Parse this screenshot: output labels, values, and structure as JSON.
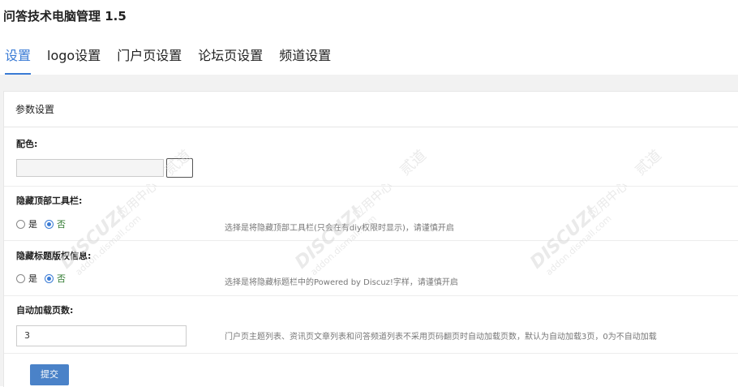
{
  "app": {
    "title": "问答技术电脑管理 1.5"
  },
  "tabs": [
    {
      "label": "设置",
      "active": true
    },
    {
      "label": "logo设置",
      "active": false
    },
    {
      "label": "门户页设置",
      "active": false
    },
    {
      "label": "论坛页设置",
      "active": false
    },
    {
      "label": "频道设置",
      "active": false
    }
  ],
  "panel": {
    "title": "参数设置"
  },
  "fields": {
    "color": {
      "label": "配色:",
      "value": ""
    },
    "hide_toolbar": {
      "label": "隐藏顶部工具栏:",
      "options": [
        "是",
        "否"
      ],
      "selected": "否",
      "tip": "选择是将隐藏顶部工具栏(只会在有diy权限时显示)，请谨慎开启"
    },
    "hide_copyright": {
      "label": "隐藏标题版权信息:",
      "options": [
        "是",
        "否"
      ],
      "selected": "否",
      "tip": "选择是将隐藏标题栏中的Powered by Discuz!字样，请谨慎开启"
    },
    "auto_load": {
      "label": "自动加载页数:",
      "value": "3",
      "tip": "门户页主题列表、资讯页文章列表和问答频道列表不采用页码翻页时自动加载页数，默认为自动加载3页，0为不自动加载"
    }
  },
  "submit_label": "提交",
  "watermark": {
    "brand": "DISCUZ!",
    "cn": "应用中心",
    "url": "addon.dismall.com",
    "sub": "贰道"
  },
  "colors": {
    "accent": "#3a7bd5",
    "button": "#4a82c8",
    "band": "#f2f2f2"
  }
}
